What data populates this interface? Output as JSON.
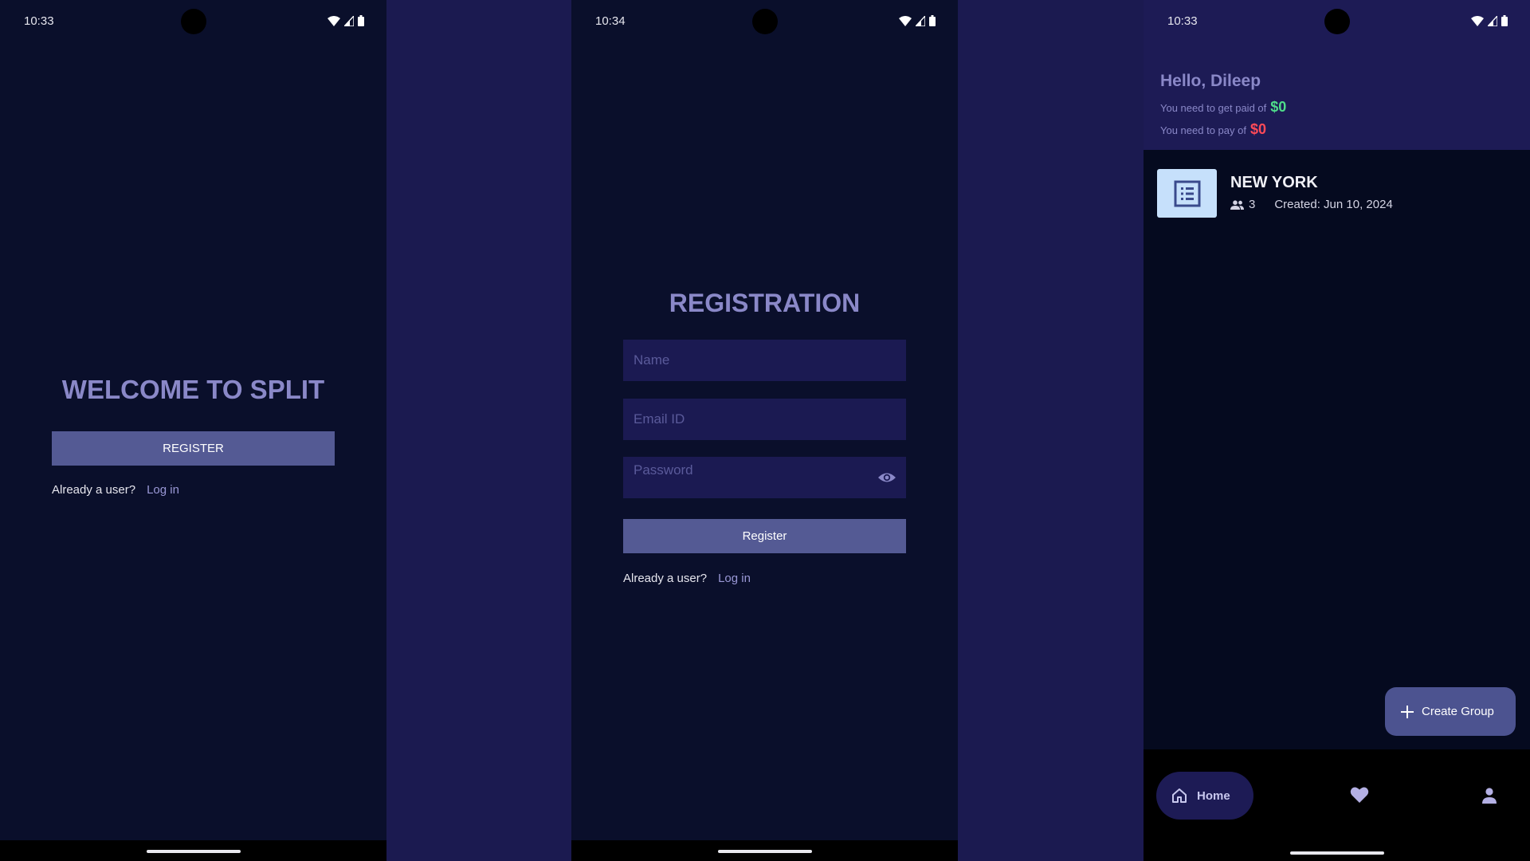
{
  "screen1": {
    "time": "10:33",
    "title": "WELCOME TO SPLIT",
    "register_label": "REGISTER",
    "already_text": "Already a user?",
    "login_label": "Log in"
  },
  "screen2": {
    "time": "10:34",
    "title": "REGISTRATION",
    "name_placeholder": "Name",
    "email_placeholder": "Email ID",
    "password_placeholder": "Password",
    "register_label": "Register",
    "already_text": "Already a user?",
    "login_label": "Log in"
  },
  "screen3": {
    "time": "10:33",
    "greeting": "Hello, Dileep",
    "paid_text": "You need to get paid of",
    "paid_amount": "$0",
    "pay_text": "You need to pay of",
    "pay_amount": "$0",
    "group": {
      "name": "NEW YORK",
      "members": "3",
      "created": "Created: Jun 10, 2024"
    },
    "fab_label": "Create Group",
    "nav": {
      "home_label": "Home"
    }
  },
  "colors": {
    "background": "#1b1a50",
    "screen_bg": "#0a0f2b",
    "accent": "#545a94",
    "title": "#8a88c8",
    "positive": "#4fdc8a",
    "negative": "#ff4a58"
  },
  "icons": [
    "wifi-icon",
    "signal-icon",
    "battery-icon",
    "eye-icon",
    "list-icon",
    "group-icon",
    "plus-icon",
    "home-icon",
    "heart-icon",
    "person-icon"
  ]
}
